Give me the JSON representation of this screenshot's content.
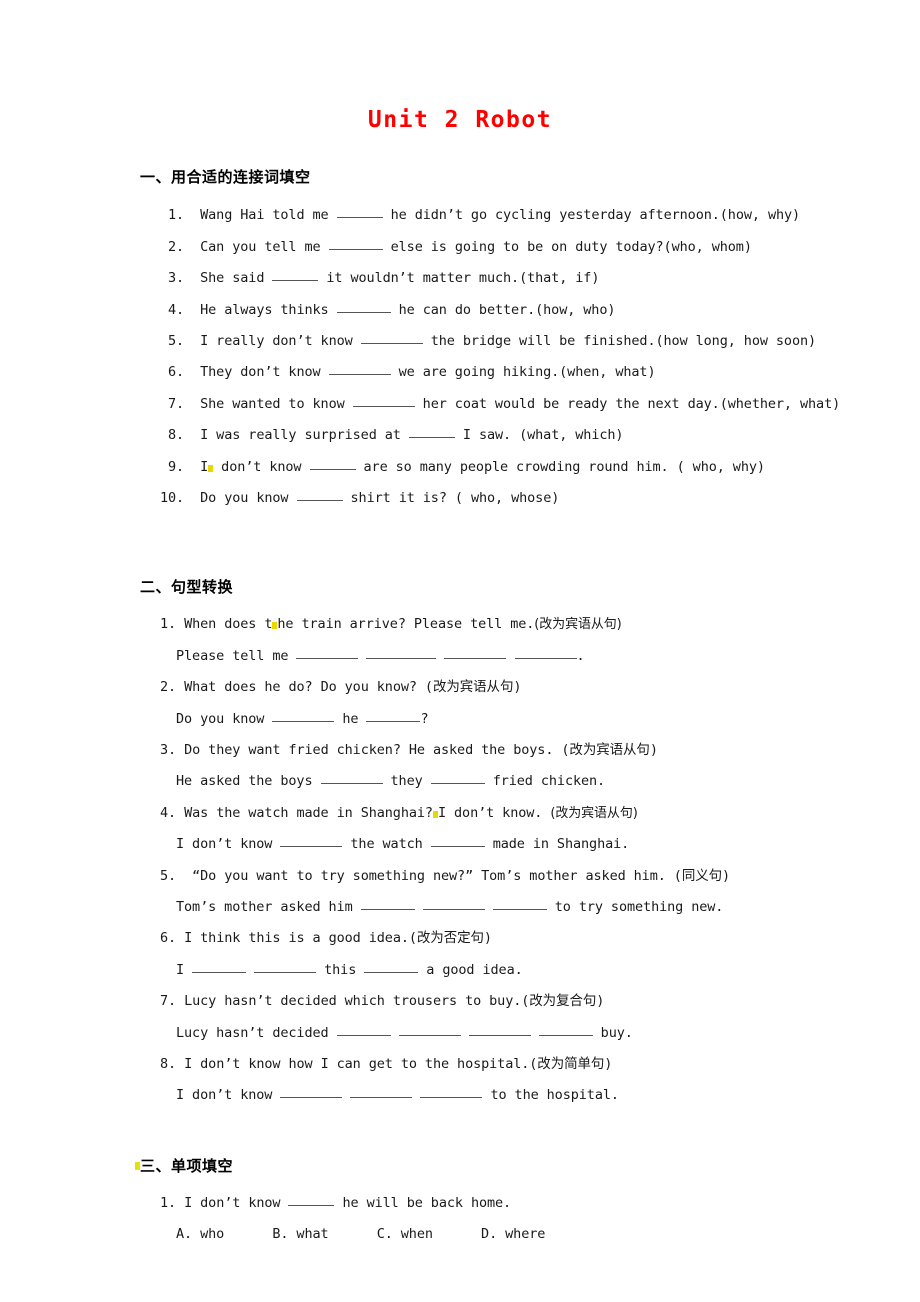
{
  "document": {
    "title": "Unit 2 Robot",
    "title_color": "#ff0000"
  },
  "sections": [
    {
      "heading": "一、用合适的连接词填空",
      "items": [
        {
          "num": "1.",
          "pre": "Wang Hai told me ",
          "blank": "b5",
          "post": " he didn’t go cycling yesterday afternoon.(how, why)"
        },
        {
          "num": "2.",
          "pre": "Can you tell me ",
          "blank": "b6",
          "post": " else is going to be on duty today?(who, whom)"
        },
        {
          "num": "3.",
          "pre": "She said ",
          "blank": "b5",
          "post": " it wouldn’t matter much.(that, if)"
        },
        {
          "num": "4.",
          "pre": "He always thinks ",
          "blank": "b6",
          "post": " he can do better.(how, who)"
        },
        {
          "num": "5.",
          "pre": "I really don’t know ",
          "blank": "b7",
          "post": " the bridge will be finished.(how long, how soon)"
        },
        {
          "num": "6.",
          "pre": "They don’t know ",
          "blank": "b7",
          "post": " we are going hiking.(when, what)"
        },
        {
          "num": "7.",
          "pre": "She wanted to know ",
          "blank": "b7",
          "post": " her coat would be ready the next day.(whether, what)"
        },
        {
          "num": "8.",
          "pre": "I was really surprised at ",
          "blank": "b5",
          "post": " I saw. (what, which)"
        },
        {
          "num": "9.",
          "pre": "I don’t know ",
          "blank": "b5",
          "post": " are so many people crowding round him. ( who, why)",
          "mark_after": "I"
        },
        {
          "num": "10.",
          "pre": "Do you know ",
          "blank": "b5",
          "post": " shirt it is? ( who, whose)"
        }
      ]
    },
    {
      "heading": "二、句型转换",
      "items": [
        {
          "num": "1.",
          "question": "When does the train arrive? Please tell me.(改为宾语从句)",
          "answer_pre": "Please tell me ",
          "answer_blanks": [
            "b7",
            "b8",
            "b7",
            "b7"
          ],
          "answer_post": "."
        },
        {
          "num": "2.",
          "question": "What does he do? Do you know? (改为宾语从句)",
          "answer_pre": "Do you know ",
          "answer_blanks": [
            "b7",
            "b6"
          ],
          "answer_mid": [
            " he ",
            ""
          ],
          "answer_post": "?"
        },
        {
          "num": "3.",
          "question": "Do they want fried chicken? He asked the boys. (改为宾语从句)",
          "answer_pre": "He asked the boys ",
          "answer_blanks": [
            "b7",
            "b6"
          ],
          "answer_mid": [
            " they ",
            ""
          ],
          "answer_post": " fried chicken."
        },
        {
          "num": "4.",
          "question": "Was the watch made in Shanghai? I don’t know. (改为宾语从句)",
          "answer_pre": "I don’t know ",
          "answer_blanks": [
            "b7",
            "b6"
          ],
          "answer_mid": [
            " the watch ",
            ""
          ],
          "answer_post": " made in Shanghai."
        },
        {
          "num": "5.",
          "question": "“Do you want to try something new?” Tom’s mother asked him. (同义句)",
          "answer_pre": "Tom’s mother asked him ",
          "answer_blanks": [
            "b6",
            "b7",
            "b6"
          ],
          "answer_post": " to try something new."
        },
        {
          "num": "6.",
          "question": "I think this is a good idea.(改为否定句)",
          "answer_pre": "I ",
          "answer_blanks": [
            "b6",
            "b7",
            "b6"
          ],
          "answer_mid": [
            "",
            " this ",
            ""
          ],
          "answer_post": " a good idea."
        },
        {
          "num": "7.",
          "question": "Lucy hasn’t decided which trousers to buy.(改为复合句)",
          "answer_pre": "Lucy hasn’t decided ",
          "answer_blanks": [
            "b6",
            "b7",
            "b7",
            "b6"
          ],
          "answer_post": " buy."
        },
        {
          "num": "8.",
          "question": "I don’t know how I can get to the hospital.(改为简单句)",
          "answer_pre": "I don’t know ",
          "answer_blanks": [
            "b7",
            "b7",
            "b7"
          ],
          "answer_post": " to the hospital."
        }
      ]
    },
    {
      "heading": "三、单项填空",
      "items": [
        {
          "num": "1.",
          "question_pre": "I don’t know ",
          "question_blank": "b5",
          "question_post": " he will be back home.",
          "options": "A. who      B. what      C. when      D. where"
        }
      ]
    }
  ]
}
